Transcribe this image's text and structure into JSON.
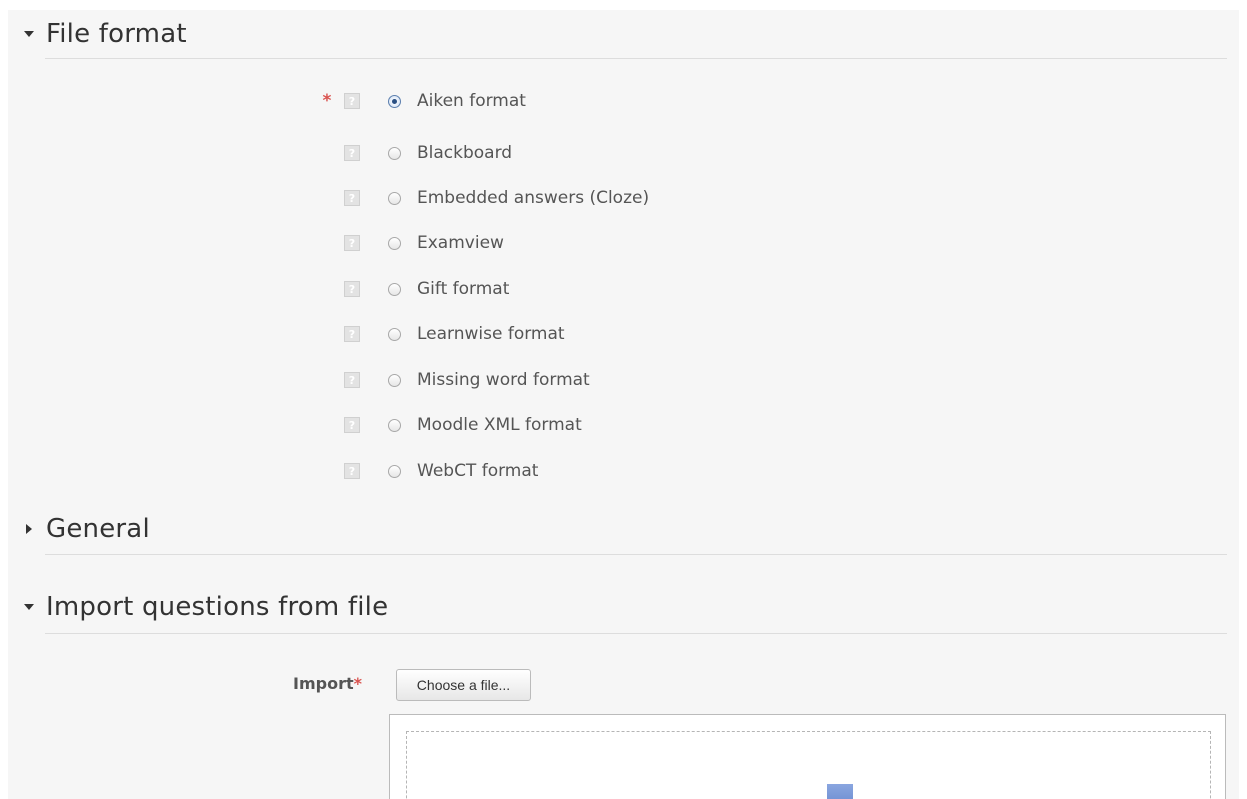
{
  "sections": {
    "file_format": {
      "title": "File format",
      "expanded": true
    },
    "general": {
      "title": "General",
      "expanded": false
    },
    "import": {
      "title": "Import questions from file",
      "expanded": true
    }
  },
  "file_format": {
    "required_marker": "*",
    "help_glyph": "?",
    "selected": "Aiken format",
    "options": [
      {
        "label": "Aiken format",
        "checked": true
      },
      {
        "label": "Blackboard",
        "checked": false
      },
      {
        "label": "Embedded answers (Cloze)",
        "checked": false
      },
      {
        "label": "Examview",
        "checked": false
      },
      {
        "label": "Gift format",
        "checked": false
      },
      {
        "label": "Learnwise format",
        "checked": false
      },
      {
        "label": "Missing word format",
        "checked": false
      },
      {
        "label": "Moodle XML format",
        "checked": false
      },
      {
        "label": "WebCT format",
        "checked": false
      }
    ]
  },
  "import_form": {
    "label": "Import",
    "required_marker": "*",
    "choose_button_label": "Choose a file...",
    "dropzone_icon": "download-arrow-icon"
  },
  "colors": {
    "required": "#d9534f",
    "radio_selected": "#2a4f82",
    "drop_arrow": "#6f8fd0"
  }
}
